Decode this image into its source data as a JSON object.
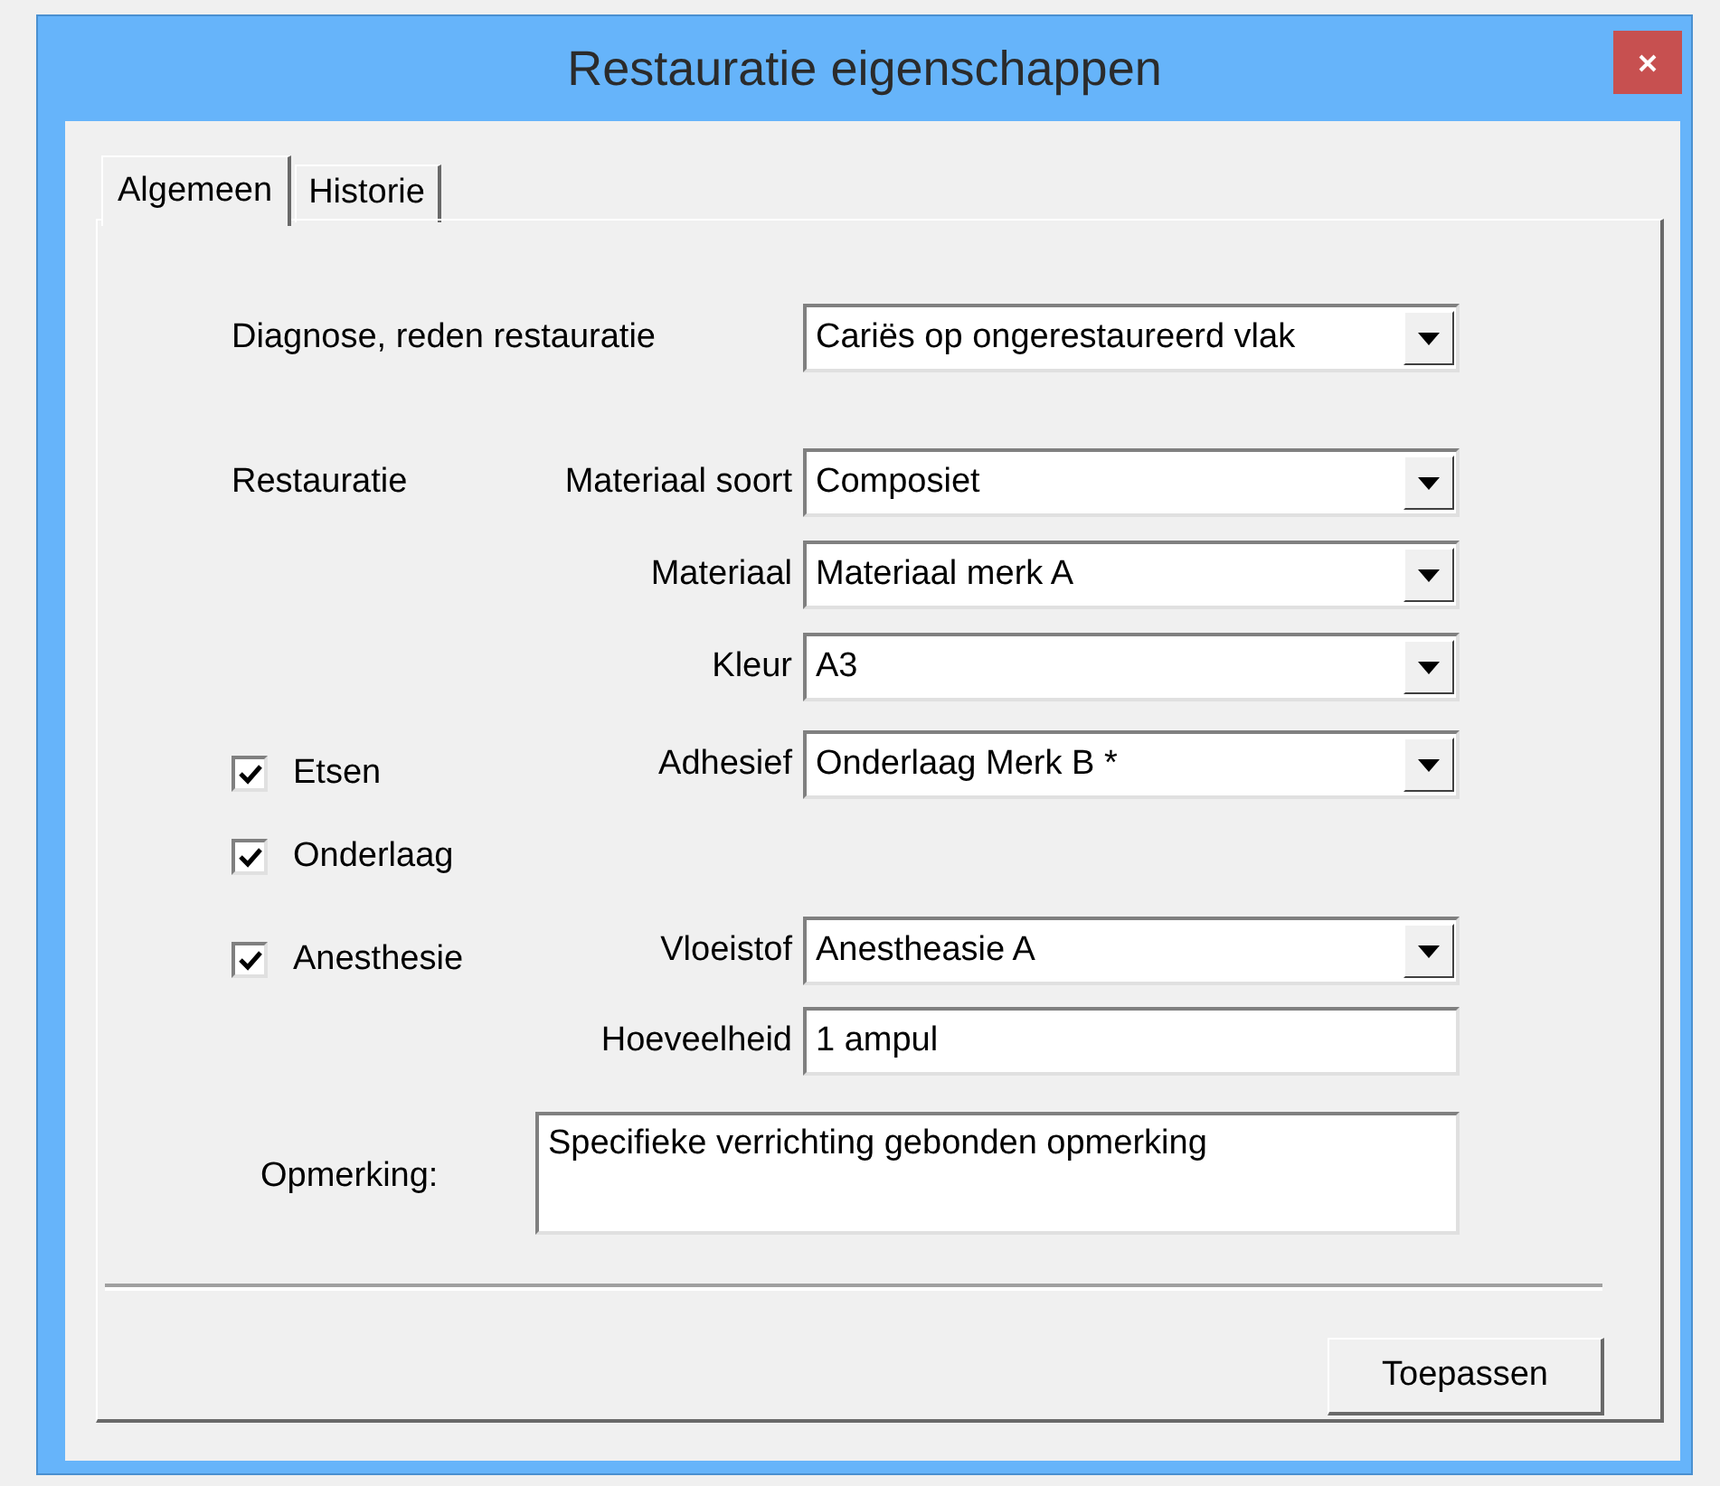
{
  "window": {
    "title": "Restauratie eigenschappen"
  },
  "tabs": [
    {
      "label": "Algemeen",
      "selected": true
    },
    {
      "label": "Historie",
      "selected": false
    }
  ],
  "rows": [
    {
      "kind": "wide_field",
      "label": "Diagnose, reden restauratie",
      "field": {
        "kind": "combo",
        "value": "Cariës op ongerestaureerd vlak"
      }
    },
    {
      "kind": "field",
      "left": {
        "kind": "text",
        "text": "Restauratie"
      },
      "label": "Materiaal soort",
      "field": {
        "kind": "combo",
        "value": "Composiet"
      }
    },
    {
      "kind": "field",
      "label": "Materiaal",
      "field": {
        "kind": "combo",
        "value": "Materiaal merk A"
      }
    },
    {
      "kind": "field",
      "label": "Kleur",
      "field": {
        "kind": "combo",
        "value": "A3"
      }
    },
    {
      "kind": "field",
      "left": {
        "kind": "checkbox",
        "label": "Etsen",
        "checked": true
      },
      "label": "Adhesief",
      "field": {
        "kind": "combo",
        "value": "Onderlaag Merk B *"
      }
    },
    {
      "kind": "field",
      "left": {
        "kind": "checkbox",
        "label": "Onderlaag",
        "checked": true
      }
    },
    {
      "kind": "field",
      "left": {
        "kind": "checkbox",
        "label": "Anesthesie",
        "checked": true
      },
      "label": "Vloeistof",
      "field": {
        "kind": "combo",
        "value": "Anestheasie A"
      }
    },
    {
      "kind": "field",
      "label": "Hoeveelheid",
      "field": {
        "kind": "text",
        "value": "1 ampul"
      }
    },
    {
      "kind": "note",
      "label": "Opmerking:",
      "field": {
        "kind": "textarea",
        "value": "Specifieke verrichting gebonden opmerking"
      }
    }
  ],
  "buttons": [
    {
      "label": "Toepassen"
    }
  ]
}
